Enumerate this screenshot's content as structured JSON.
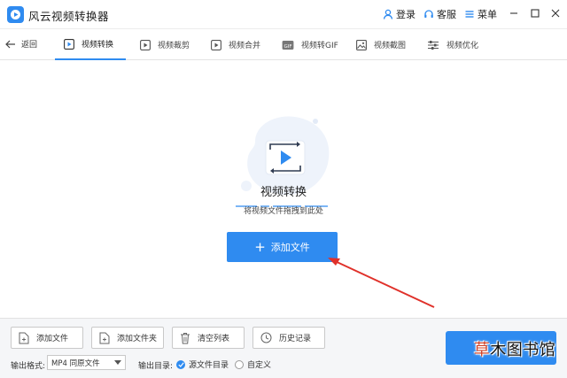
{
  "app": {
    "title": "风云视频转换器",
    "login": "登录",
    "service": "客服",
    "menu": "菜单"
  },
  "toolbar": {
    "back_label": "返回",
    "tabs": [
      {
        "label": "视频转换",
        "icon": "play-square-icon",
        "active": true
      },
      {
        "label": "视频裁剪",
        "icon": "crop-icon",
        "active": false
      },
      {
        "label": "视频合并",
        "icon": "merge-icon",
        "active": false
      },
      {
        "label": "视频转GIF",
        "icon": "gif-icon",
        "active": false
      },
      {
        "label": "视频截图",
        "icon": "image-icon",
        "active": false
      },
      {
        "label": "视频优化",
        "icon": "sliders-icon",
        "active": false
      }
    ]
  },
  "main": {
    "title": "视频转换",
    "hint": "将视频文件拖拽到此处",
    "add_button": "添加文件"
  },
  "bottom": {
    "buttons": [
      {
        "label": "添加文件",
        "icon": "file-add-icon"
      },
      {
        "label": "添加文件夹",
        "icon": "folder-add-icon"
      },
      {
        "label": "清空列表",
        "icon": "trash-icon"
      },
      {
        "label": "历史记录",
        "icon": "history-icon"
      }
    ],
    "format_label": "输出格式:",
    "format_value": "MP4 同原文件",
    "dir_label": "输出目录:",
    "dir_options": [
      {
        "label": "源文件目录",
        "selected": true
      },
      {
        "label": "自定义",
        "selected": false
      }
    ]
  },
  "watermark": {
    "highlight": "草",
    "rest": "木图书馆"
  },
  "colors": {
    "accent": "#2f8bf0",
    "annotation_arrow": "#e0312a"
  }
}
